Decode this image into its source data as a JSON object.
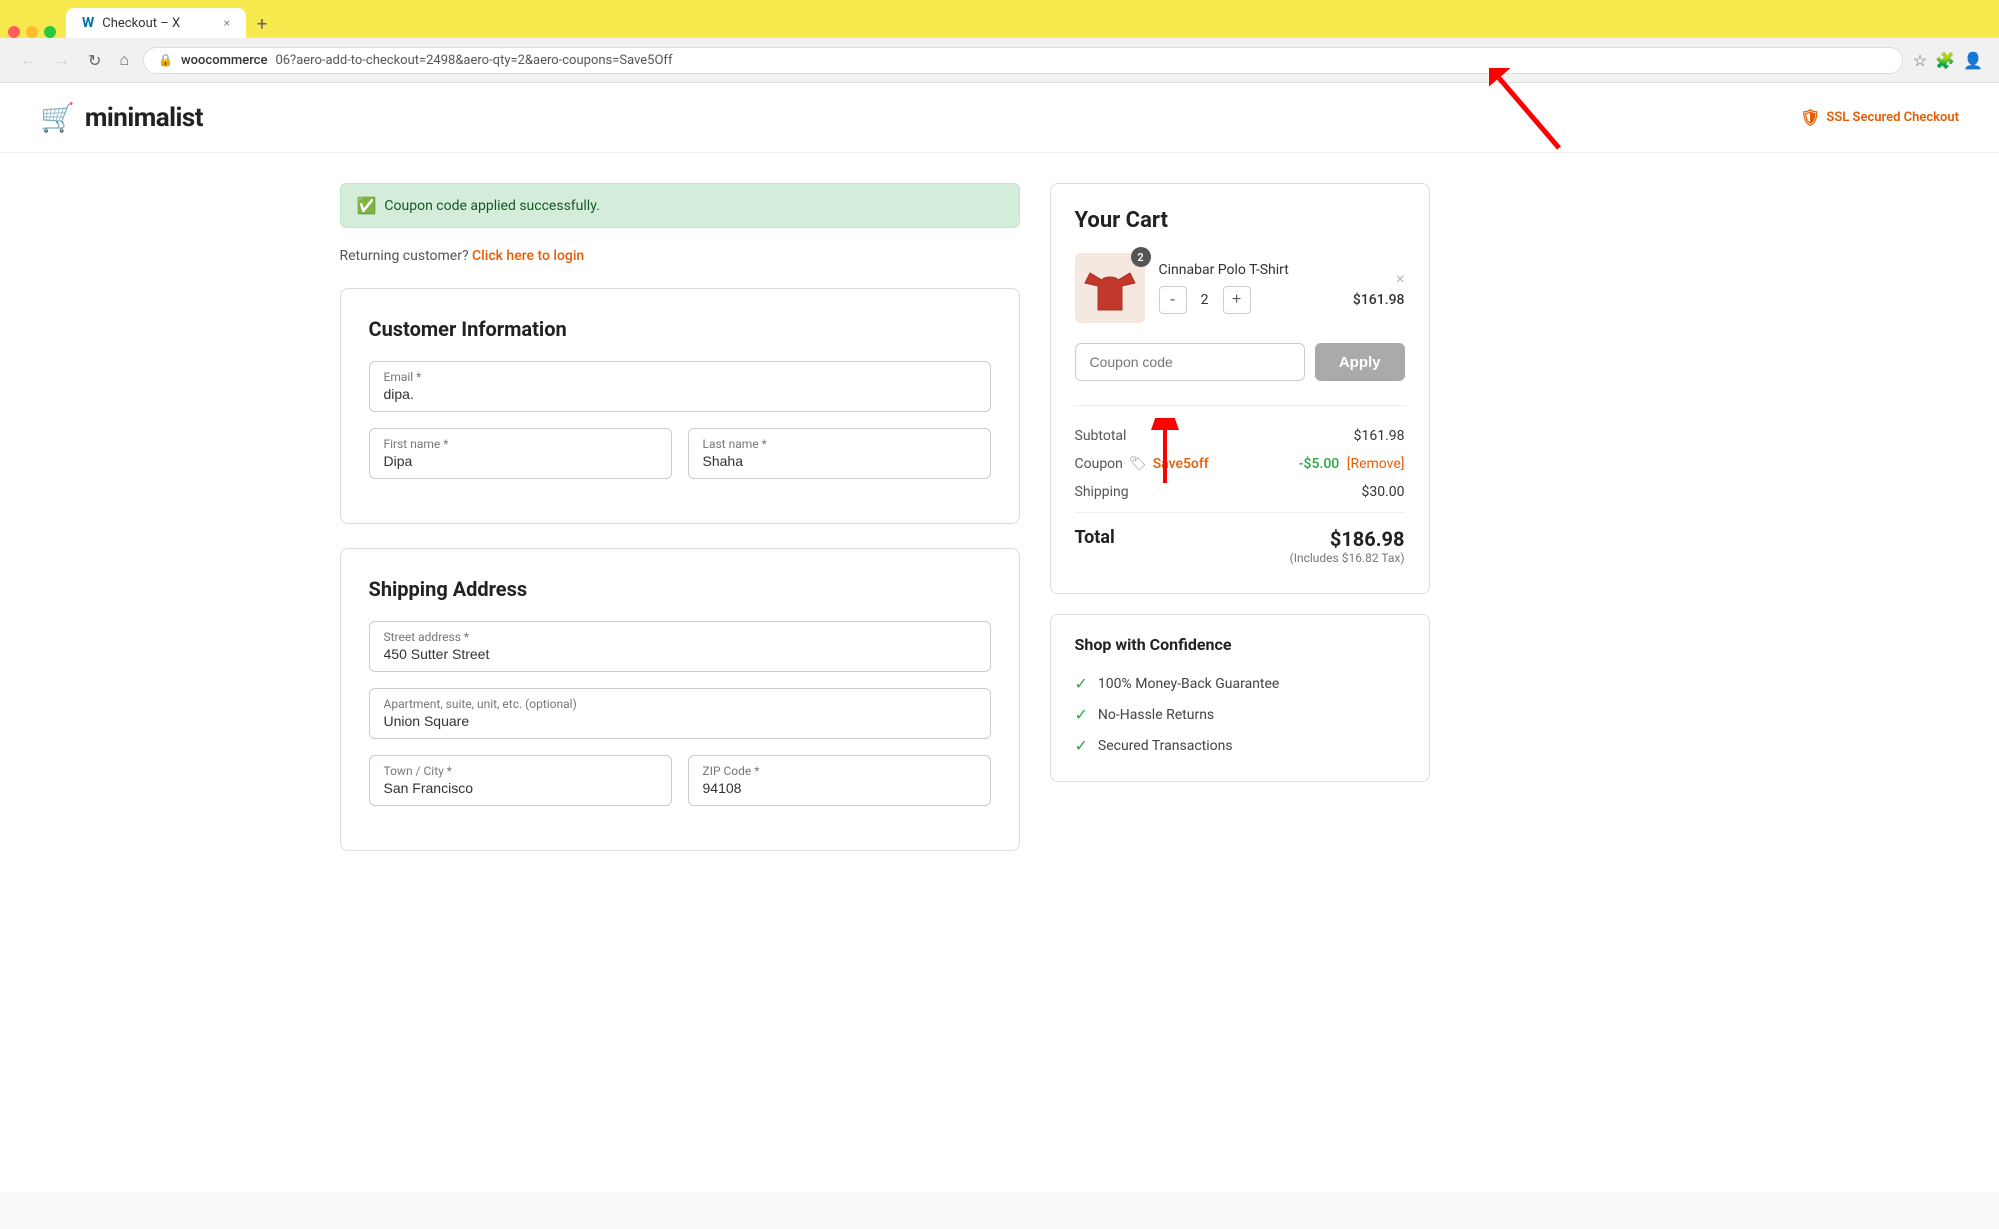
{
  "browser": {
    "tab_label": "Checkout – X",
    "tab_close": "×",
    "tab_new": "+",
    "domain": "woocommerce",
    "url_partial": "06?aero-add-to-checkout=2498&aero-qty=2&aero-coupons=Save5Off",
    "nav_back": "←",
    "nav_forward": "→",
    "nav_refresh": "↻",
    "nav_home": "⌂"
  },
  "header": {
    "logo_text_thin": "mini",
    "logo_text_bold": "malist",
    "ssl_text": "SSL Secured Checkout"
  },
  "alerts": {
    "success_message": "Coupon code applied successfully."
  },
  "returning_customer": {
    "text": "Returning customer?",
    "link_text": "Click here to login"
  },
  "customer_info": {
    "section_title": "Customer Information",
    "email_label": "Email *",
    "email_value": "dipa.",
    "email_placeholder": "",
    "first_name_label": "First name *",
    "first_name_value": "Dipa",
    "last_name_label": "Last name *",
    "last_name_value": "Shaha"
  },
  "shipping_address": {
    "section_title": "Shipping Address",
    "street_label": "Street address *",
    "street_value": "450 Sutter Street",
    "apt_label": "Apartment, suite, unit, etc. (optional)",
    "apt_value": "Union Square",
    "city_label": "Town / City *",
    "city_value": "San Francisco",
    "zip_label": "ZIP Code *",
    "zip_value": "94108"
  },
  "cart": {
    "title": "Your Cart",
    "item_name": "Cinnabar Polo T-Shirt",
    "item_price": "$161.98",
    "item_qty": "2",
    "item_badge": "2",
    "qty_minus": "-",
    "qty_plus": "+",
    "remove_icon": "×",
    "coupon_placeholder": "Coupon code",
    "apply_label": "Apply",
    "subtotal_label": "Subtotal",
    "subtotal_value": "$161.98",
    "coupon_label": "Coupon",
    "coupon_tag": "🏷",
    "coupon_code": "Save5off",
    "coupon_discount": "-$5.00",
    "coupon_remove": "[Remove]",
    "shipping_label": "Shipping",
    "shipping_value": "$30.00",
    "total_label": "Total",
    "total_value": "$186.98",
    "tax_note": "(Includes $16.82 Tax)"
  },
  "confidence": {
    "title": "Shop with Confidence",
    "items": [
      "100% Money-Back Guarantee",
      "No-Hassle Returns",
      "Secured Transactions"
    ]
  }
}
